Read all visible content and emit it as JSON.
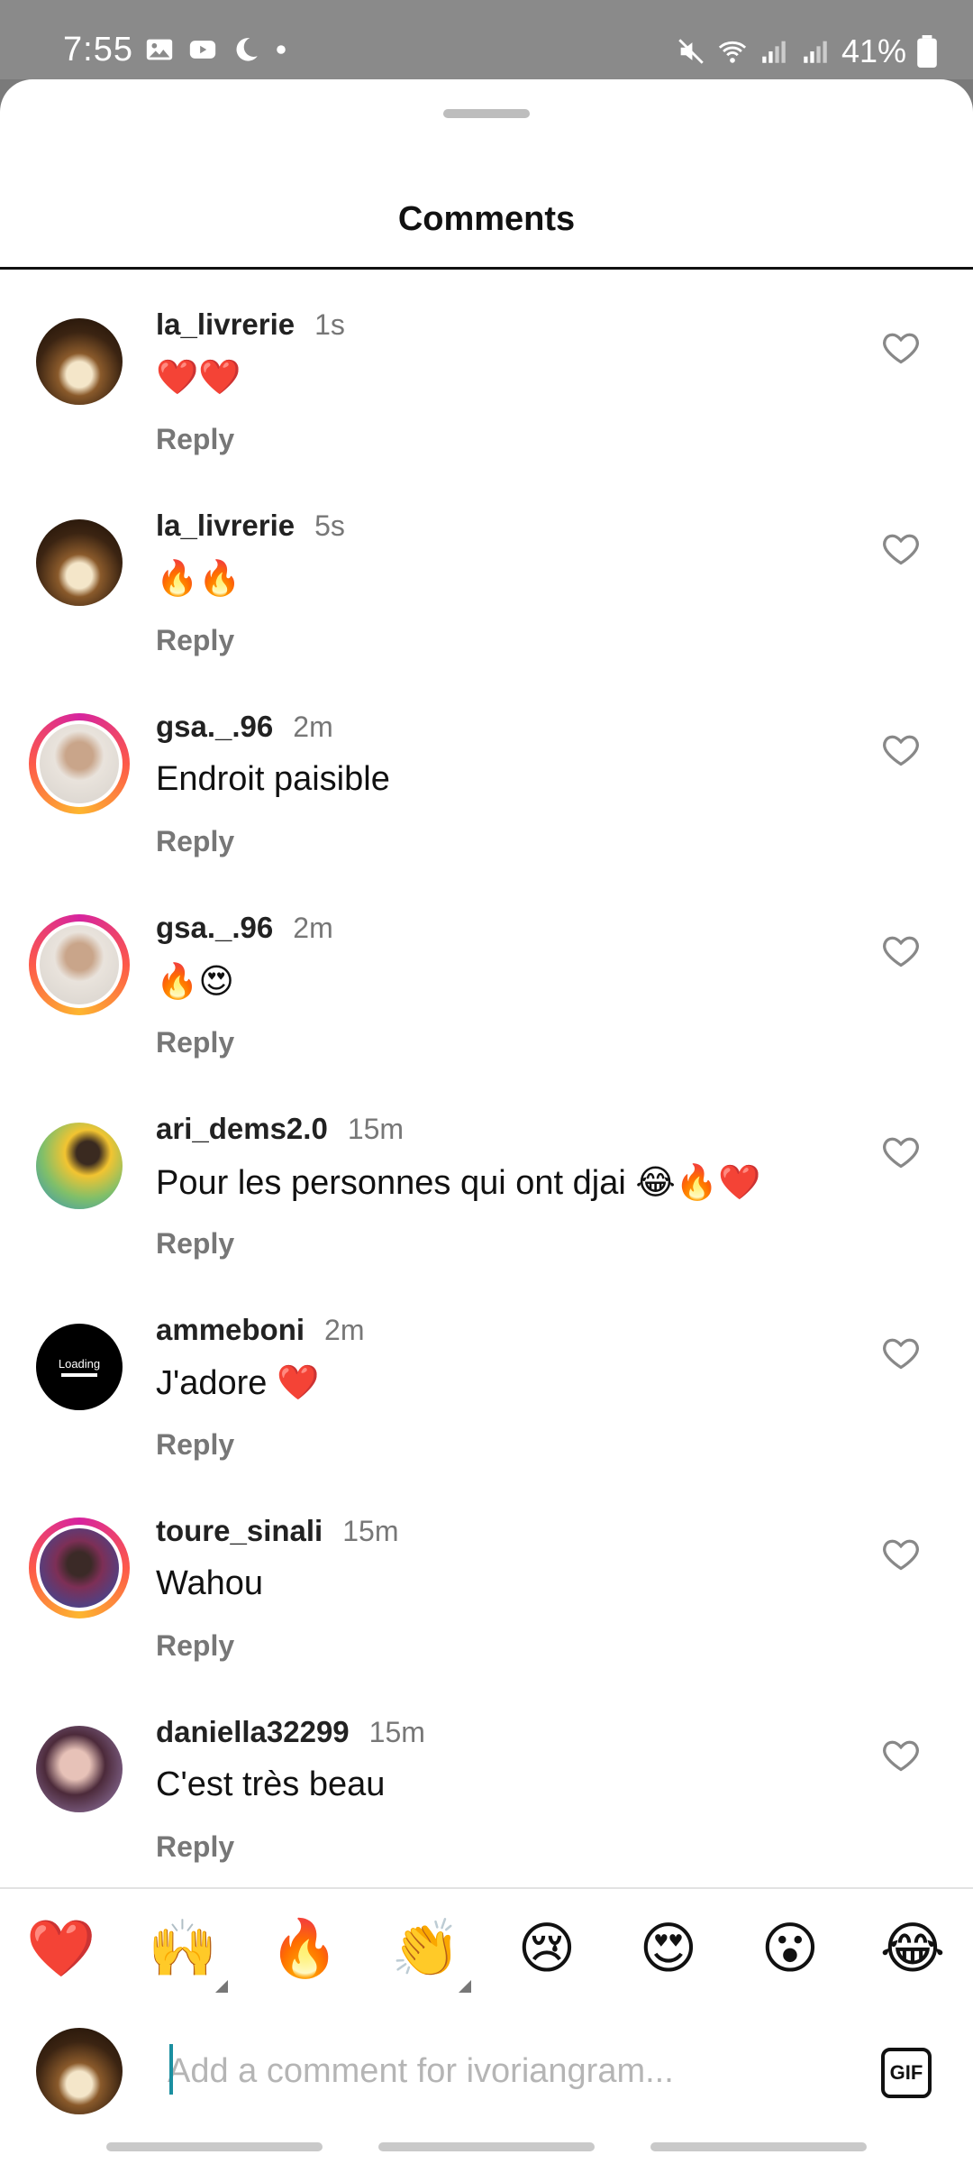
{
  "status_bar": {
    "time": "7:55",
    "battery": "41%"
  },
  "sheet": {
    "title": "Comments"
  },
  "comments": [
    {
      "user": "la_livrerie",
      "time": "1s",
      "text": "❤️❤️",
      "reply": "Reply",
      "avatar": "books",
      "story": false
    },
    {
      "user": "la_livrerie",
      "time": "5s",
      "text": "🔥🔥",
      "reply": "Reply",
      "avatar": "books",
      "story": false
    },
    {
      "user": "gsa._.96",
      "time": "2m",
      "text": "Endroit paisible",
      "reply": "Reply",
      "avatar": "man",
      "story": true
    },
    {
      "user": "gsa._.96",
      "time": "2m",
      "text": "🔥😍",
      "reply": "Reply",
      "avatar": "man",
      "story": true
    },
    {
      "user": "ari_dems2.0",
      "time": "15m",
      "text": "Pour les personnes qui ont djai 😂🔥❤️",
      "reply": "Reply",
      "avatar": "green",
      "story": false
    },
    {
      "user": "ammeboni",
      "time": "2m",
      "text": "J'adore ❤️",
      "reply": "Reply",
      "avatar": "loading",
      "story": false
    },
    {
      "user": "toure_sinali",
      "time": "15m",
      "text": "Wahou",
      "reply": "Reply",
      "avatar": "purple",
      "story": true
    },
    {
      "user": "daniella32299",
      "time": "15m",
      "text": "C'est très beau",
      "reply": "Reply",
      "avatar": "girl",
      "story": false
    }
  ],
  "loading_avatar_text": "Loading",
  "reactions": [
    "❤️",
    "🙌",
    "🔥",
    "👏",
    "😢",
    "😍",
    "😮",
    "😂"
  ],
  "composer": {
    "placeholder": "Add a comment for ivoriangram...",
    "gif_label": "GIF"
  }
}
